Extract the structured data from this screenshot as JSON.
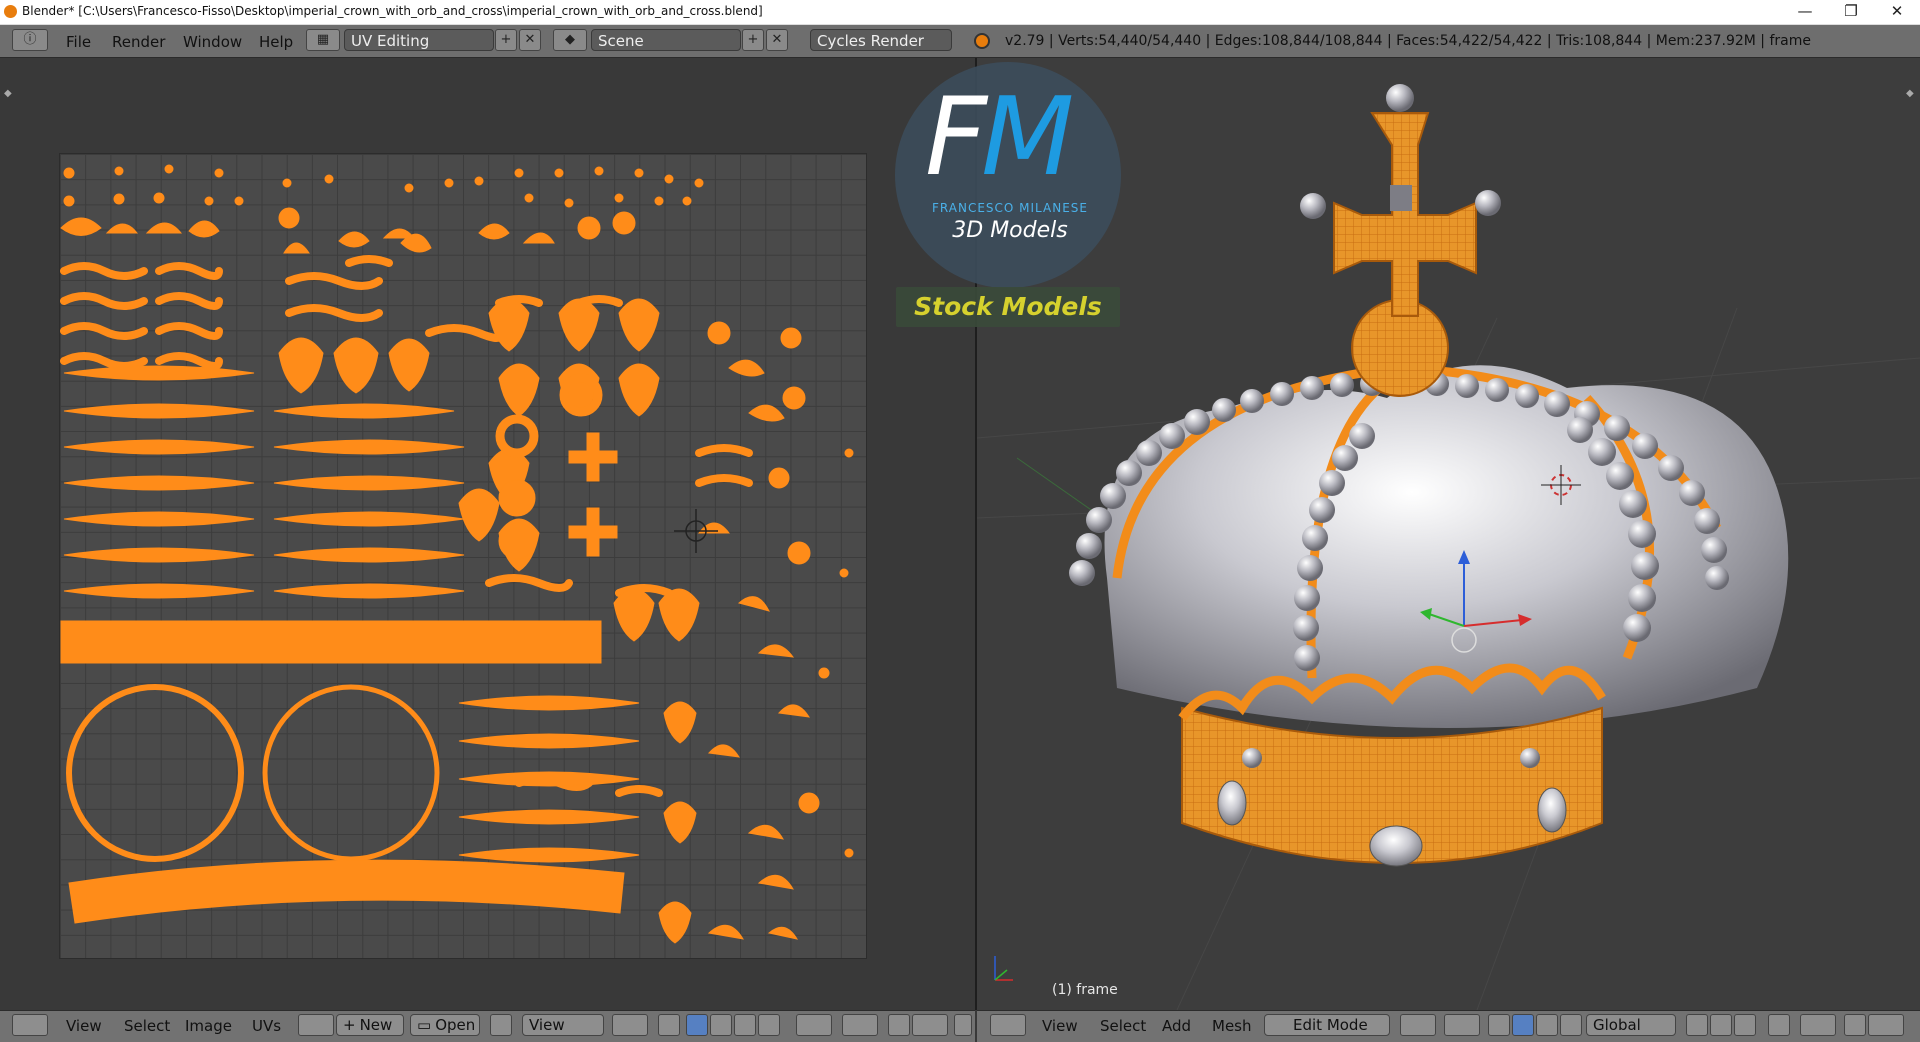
{
  "window": {
    "title": "Blender* [C:\\Users\\Francesco-Fisso\\Desktop\\imperial_crown_with_orb_and_cross\\imperial_crown_with_orb_and_cross.blend]",
    "controls": [
      "—",
      "❐",
      "✕"
    ]
  },
  "info_header": {
    "menus": [
      "File",
      "Render",
      "Window",
      "Help"
    ],
    "screen_layout": "UV Editing",
    "scene": "Scene",
    "render_engine": "Cycles Render",
    "stats": "v2.79 | Verts:54,440/54,440 | Edges:108,844/108,844 | Faces:54,422/54,422 | Tris:108,844 | Mem:237.92M | frame"
  },
  "watermark": {
    "logo_letters": [
      "F",
      "M"
    ],
    "brand_name": "FRANCESCO MILANESE",
    "subtitle": "3D Models",
    "banner": "Stock Models"
  },
  "uv_editor": {
    "header_menus": [
      "View",
      "Select",
      "Image",
      "UVs"
    ],
    "new_label": "New",
    "open_label": "Open",
    "view_select": "View"
  },
  "viewport": {
    "frame_label": "(1) frame",
    "header_menus": [
      "View",
      "Select",
      "Add",
      "Mesh"
    ],
    "mode": "Edit Mode",
    "transform_orientation": "Global"
  },
  "colors": {
    "uv_island": "#ff8c19",
    "mesh_selected": "#f28c1a",
    "header_bg": "#6e6e6e",
    "editor_bg": "#393939",
    "brand_blue": "#1e9be1",
    "stock_yellow": "#d6d12e"
  }
}
